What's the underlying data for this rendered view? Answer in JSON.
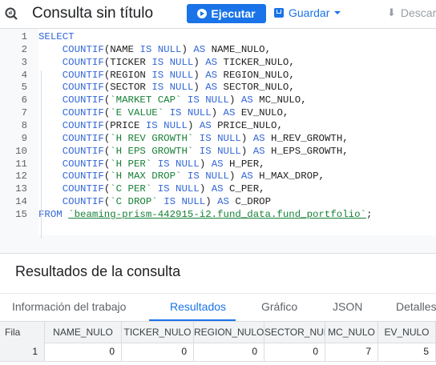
{
  "header": {
    "title": "Consulta sin título",
    "icon": "query-icon",
    "run_label": "Ejecutar",
    "save_label": "Guardar",
    "download_label": "Descar"
  },
  "editor": {
    "line_numbers": [
      "1",
      "2",
      "3",
      "4",
      "5",
      "6",
      "7",
      "8",
      "9",
      "10",
      "11",
      "12",
      "13",
      "14",
      "15"
    ],
    "lines": [
      [
        [
          "kw",
          "SELECT"
        ]
      ],
      [
        [
          "tx",
          "    "
        ],
        [
          "kw",
          "COUNTIF"
        ],
        [
          "tx",
          "(NAME "
        ],
        [
          "kw",
          "IS NULL"
        ],
        [
          "tx",
          ") "
        ],
        [
          "kw",
          "AS"
        ],
        [
          "tx",
          " NAME_NULO,"
        ]
      ],
      [
        [
          "tx",
          "    "
        ],
        [
          "kw",
          "COUNTIF"
        ],
        [
          "tx",
          "(TICKER "
        ],
        [
          "kw",
          "IS NULL"
        ],
        [
          "tx",
          ") "
        ],
        [
          "kw",
          "AS"
        ],
        [
          "tx",
          " TICKER_NULO,"
        ]
      ],
      [
        [
          "tx",
          "    "
        ],
        [
          "kw",
          "COUNTIF"
        ],
        [
          "tx",
          "(REGION "
        ],
        [
          "kw",
          "IS NULL"
        ],
        [
          "tx",
          ") "
        ],
        [
          "kw",
          "AS"
        ],
        [
          "tx",
          " REGION_NULO,"
        ]
      ],
      [
        [
          "tx",
          "    "
        ],
        [
          "kw",
          "COUNTIF"
        ],
        [
          "tx",
          "(SECTOR "
        ],
        [
          "kw",
          "IS NULL"
        ],
        [
          "tx",
          ") "
        ],
        [
          "kw",
          "AS"
        ],
        [
          "tx",
          " SECTOR_NULO,"
        ]
      ],
      [
        [
          "tx",
          "    "
        ],
        [
          "kw",
          "COUNTIF"
        ],
        [
          "tx",
          "("
        ],
        [
          "id",
          "`MARKET CAP`"
        ],
        [
          "tx",
          " "
        ],
        [
          "kw",
          "IS NULL"
        ],
        [
          "tx",
          ") "
        ],
        [
          "kw",
          "AS"
        ],
        [
          "tx",
          " MC_NULO,"
        ]
      ],
      [
        [
          "tx",
          "    "
        ],
        [
          "kw",
          "COUNTIF"
        ],
        [
          "tx",
          "("
        ],
        [
          "id",
          "`E VALUE`"
        ],
        [
          "tx",
          " "
        ],
        [
          "kw",
          "IS NULL"
        ],
        [
          "tx",
          ") "
        ],
        [
          "kw",
          "AS"
        ],
        [
          "tx",
          " EV_NULO,"
        ]
      ],
      [
        [
          "tx",
          "    "
        ],
        [
          "kw",
          "COUNTIF"
        ],
        [
          "tx",
          "(PRICE "
        ],
        [
          "kw",
          "IS NULL"
        ],
        [
          "tx",
          ") "
        ],
        [
          "kw",
          "AS"
        ],
        [
          "tx",
          " PRICE_NULO,"
        ]
      ],
      [
        [
          "tx",
          "    "
        ],
        [
          "kw",
          "COUNTIF"
        ],
        [
          "tx",
          "("
        ],
        [
          "id",
          "`H REV GROWTH`"
        ],
        [
          "tx",
          " "
        ],
        [
          "kw",
          "IS NULL"
        ],
        [
          "tx",
          ") "
        ],
        [
          "kw",
          "AS"
        ],
        [
          "tx",
          " H_REV_GROWTH,"
        ]
      ],
      [
        [
          "tx",
          "    "
        ],
        [
          "kw",
          "COUNTIF"
        ],
        [
          "tx",
          "("
        ],
        [
          "id",
          "`H EPS GROWTH`"
        ],
        [
          "tx",
          " "
        ],
        [
          "kw",
          "IS NULL"
        ],
        [
          "tx",
          ") "
        ],
        [
          "kw",
          "AS"
        ],
        [
          "tx",
          " H_EPS_GROWTH,"
        ]
      ],
      [
        [
          "tx",
          "    "
        ],
        [
          "kw",
          "COUNTIF"
        ],
        [
          "tx",
          "("
        ],
        [
          "id",
          "`H PER`"
        ],
        [
          "tx",
          " "
        ],
        [
          "kw",
          "IS NULL"
        ],
        [
          "tx",
          ") "
        ],
        [
          "kw",
          "AS"
        ],
        [
          "tx",
          " H_PER,"
        ]
      ],
      [
        [
          "tx",
          "    "
        ],
        [
          "kw",
          "COUNTIF"
        ],
        [
          "tx",
          "("
        ],
        [
          "id",
          "`H MAX DROP`"
        ],
        [
          "tx",
          " "
        ],
        [
          "kw",
          "IS NULL"
        ],
        [
          "tx",
          ") "
        ],
        [
          "kw",
          "AS"
        ],
        [
          "tx",
          " H_MAX_DROP,"
        ]
      ],
      [
        [
          "tx",
          "    "
        ],
        [
          "kw",
          "COUNTIF"
        ],
        [
          "tx",
          "("
        ],
        [
          "id",
          "`C PER`"
        ],
        [
          "tx",
          " "
        ],
        [
          "kw",
          "IS NULL"
        ],
        [
          "tx",
          ") "
        ],
        [
          "kw",
          "AS"
        ],
        [
          "tx",
          " C_PER,"
        ]
      ],
      [
        [
          "tx",
          "    "
        ],
        [
          "kw",
          "COUNTIF"
        ],
        [
          "tx",
          "("
        ],
        [
          "id",
          "`C DROP`"
        ],
        [
          "tx",
          " "
        ],
        [
          "kw",
          "IS NULL"
        ],
        [
          "tx",
          ") "
        ],
        [
          "kw",
          "AS"
        ],
        [
          "tx",
          " C_DROP"
        ]
      ],
      [
        [
          "kw",
          "FROM"
        ],
        [
          "tx",
          " "
        ],
        [
          "tb",
          "`beaming-prism-442915-i2.fund_data.fund_portfolio`"
        ],
        [
          "tx",
          ";"
        ]
      ]
    ]
  },
  "results": {
    "title": "Resultados de la consulta",
    "tabs": [
      "Información del trabajo",
      "Resultados",
      "Gráfico",
      "JSON",
      "Detalles"
    ],
    "active_tab": "Resultados",
    "columns": [
      "Fila",
      "NAME_NULO",
      "TICKER_NULO",
      "REGION_NULO",
      "SECTOR_NULO",
      "MC_NULO",
      "EV_NULO"
    ],
    "rows": [
      [
        "1",
        "0",
        "0",
        "0",
        "0",
        "7",
        "5"
      ]
    ]
  },
  "colors": {
    "accent": "#1a73e8",
    "keyword": "#3367d6",
    "identifier": "#188038"
  }
}
